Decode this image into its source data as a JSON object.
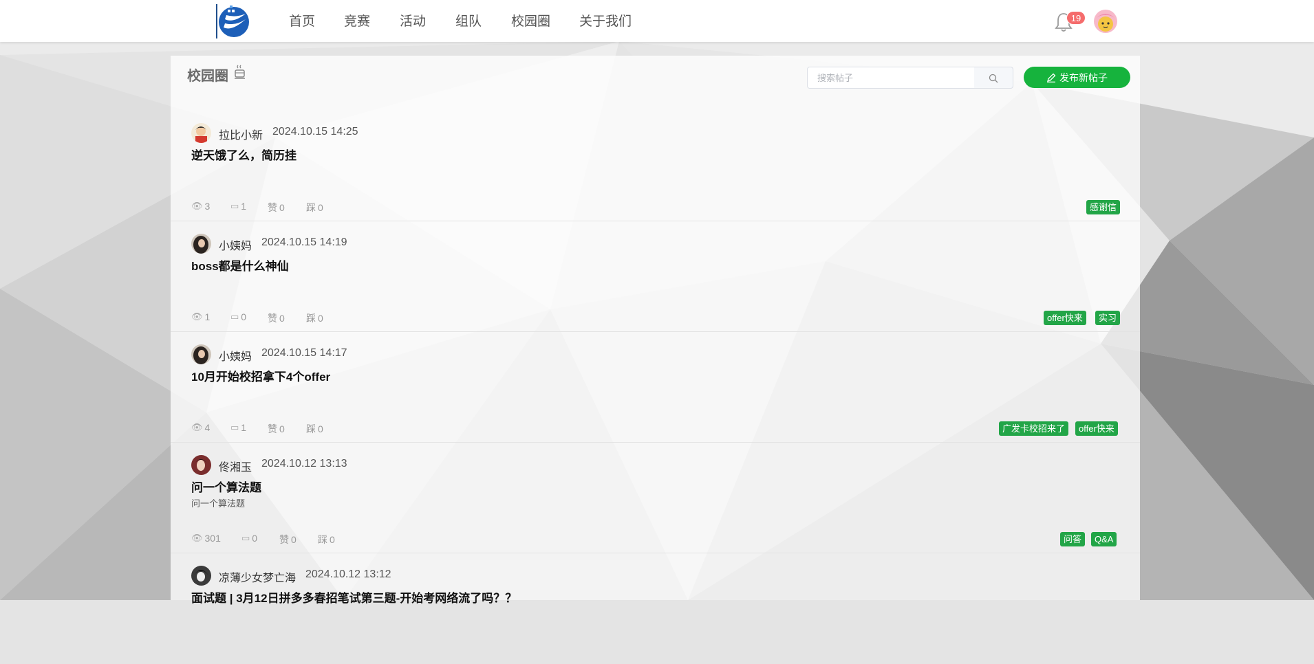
{
  "nav": {
    "items": [
      {
        "label": "首页"
      },
      {
        "label": "竞赛"
      },
      {
        "label": "活动"
      },
      {
        "label": "组队"
      },
      {
        "label": "校园圈"
      },
      {
        "label": "关于我们"
      }
    ],
    "notification_count": "19",
    "icons": {
      "bell": "bell-icon",
      "avatar": "user-avatar"
    }
  },
  "panel": {
    "title": "校园圈",
    "title_icon": "coffee-cup-icon",
    "search_placeholder": "搜索帖子",
    "search_icon": "search-icon",
    "new_post_label": "发布新帖子",
    "new_post_icon": "pencil-icon"
  },
  "stat_labels": {
    "like": "赞",
    "dislike": "踩"
  },
  "stat_icons": {
    "views": "eye-icon",
    "comments": "comment-icon"
  },
  "colors": {
    "accent": "#16b33d",
    "tag": "#22a547",
    "badge": "#f56c6c"
  },
  "posts": [
    {
      "author": "拉比小新",
      "time": "2024.10.15 14:25",
      "title": "逆天饿了么，简历挂",
      "excerpt": "",
      "views": "3",
      "comments": "1",
      "likes": "0",
      "dislikes": "0",
      "tags": [
        "感谢信"
      ]
    },
    {
      "author": "小姨妈",
      "time": "2024.10.15 14:19",
      "title": "boss都是什么神仙",
      "excerpt": "",
      "views": "1",
      "comments": "0",
      "likes": "0",
      "dislikes": "0",
      "tags": [
        "offer快来",
        "实习"
      ]
    },
    {
      "author": "小姨妈",
      "time": "2024.10.15 14:17",
      "title": "10月开始校招拿下4个offer",
      "excerpt": "",
      "views": "4",
      "comments": "1",
      "likes": "0",
      "dislikes": "0",
      "tags": [
        "广发卡校招来了",
        "offer快来"
      ]
    },
    {
      "author": "佟湘玉",
      "time": "2024.10.12 13:13",
      "title": "问一个算法题",
      "excerpt": "问一个算法题",
      "views": "301",
      "comments": "0",
      "likes": "0",
      "dislikes": "0",
      "tags": [
        "问答",
        "Q&A"
      ]
    },
    {
      "author": "凉薄少女梦亡海",
      "time": "2024.10.12 13:12",
      "title": "面试题 | 3月12日拼多多春招笔试第三题-开始考网络流了吗？？",
      "excerpt": "",
      "views": "",
      "comments": "",
      "likes": "",
      "dislikes": "",
      "tags": []
    }
  ]
}
